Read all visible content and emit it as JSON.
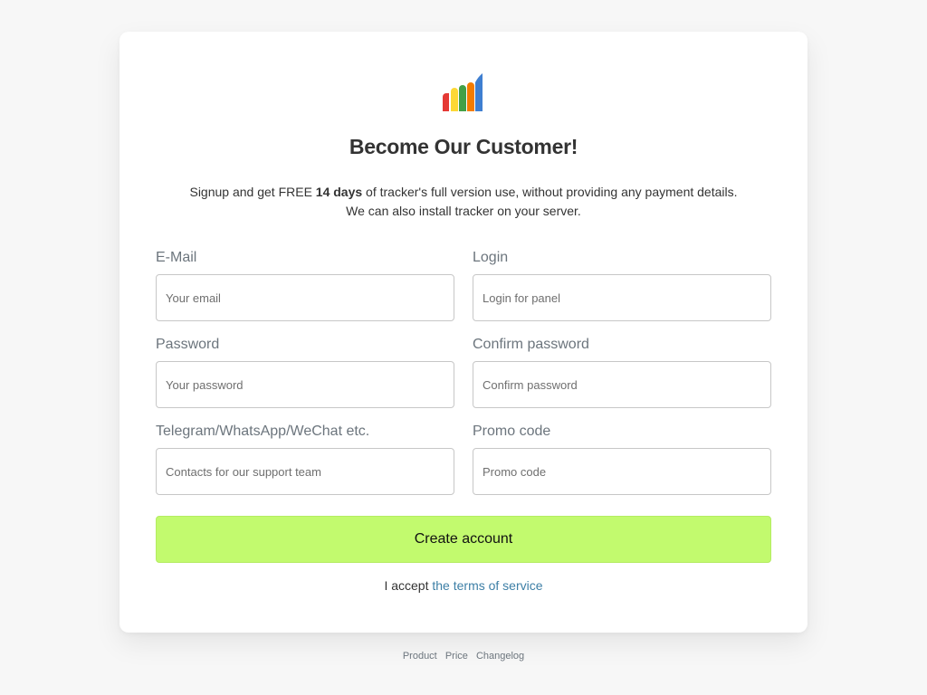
{
  "logo": {
    "icon": "bar-chart-logo-icon",
    "colors": [
      "#e53935",
      "#fdd835",
      "#43a047",
      "#f57c00",
      "#3f7fd1"
    ]
  },
  "title": "Become Our Customer!",
  "description": {
    "line1_prefix": "Signup and get FREE ",
    "line1_bold": "14 days",
    "line1_suffix": " of tracker's full version use, without providing any payment details.",
    "line2": "We can also install tracker on your server."
  },
  "form": {
    "email": {
      "label": "E-Mail",
      "placeholder": "Your email"
    },
    "login": {
      "label": "Login",
      "placeholder": "Login for panel"
    },
    "password": {
      "label": "Password",
      "placeholder": "Your password"
    },
    "confirm_password": {
      "label": "Confirm password",
      "placeholder": "Confirm password"
    },
    "contacts": {
      "label": "Telegram/WhatsApp/WeChat etc.",
      "placeholder": "Contacts for our support team"
    },
    "promo": {
      "label": "Promo code",
      "placeholder": "Promo code"
    },
    "submit_label": "Create account",
    "submit_color": "#c2fa6e"
  },
  "terms": {
    "prefix": "I accept ",
    "link": "the terms of service",
    "link_color": "#3d7fa6"
  },
  "footer": {
    "links": [
      "Product",
      "Price",
      "Changelog"
    ]
  }
}
